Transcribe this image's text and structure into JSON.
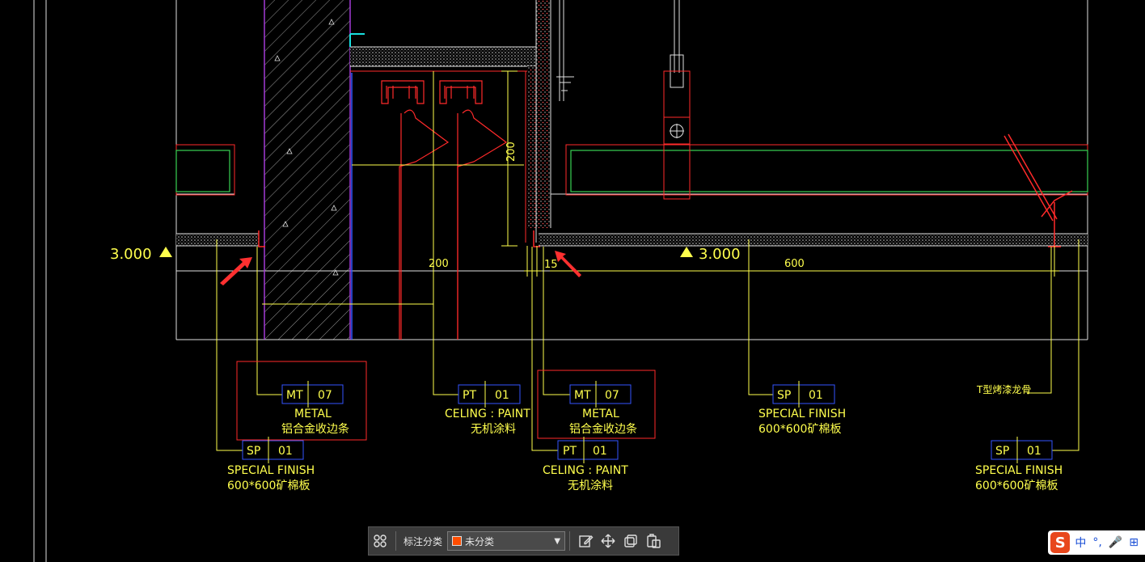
{
  "drawing": {
    "elevations": [
      "3.000",
      "3.000"
    ],
    "dimensions": {
      "d200_horizontal": "200",
      "d200_vertical": "200",
      "d15": "15",
      "d600": "600"
    },
    "callouts": [
      {
        "code": "MT",
        "number": "07",
        "line1": "METAL",
        "line2": "铝合金收边条",
        "boxed": true
      },
      {
        "code": "SP",
        "number": "01",
        "line1": "SPECIAL FINISH",
        "line2": "600*600矿棉板"
      },
      {
        "code": "PT",
        "number": "01",
        "line1": "CELING : PAINT",
        "line2": "无机涂料"
      },
      {
        "code": "MT",
        "number": "07",
        "line1": "METAL",
        "line2": "铝合金收边条",
        "boxed": true
      },
      {
        "code": "PT",
        "number": "01",
        "line1": "CELING : PAINT",
        "line2": "无机涂料"
      },
      {
        "code": "SP",
        "number": "01",
        "line1": "SPECIAL FINISH",
        "line2": "600*600矿棉板"
      },
      {
        "code": "SP",
        "number": "01",
        "line1": "SPECIAL FINISH",
        "line2": "600*600矿棉板"
      }
    ],
    "note_t_keel": "T型烤漆龙骨",
    "colors": {
      "background": "#000000",
      "yellow": "#ffff4d",
      "red": "#ff2a2a",
      "green": "#39d353",
      "purple": "#a23ad6",
      "blue": "#3355ff",
      "white": "#e0e0e0",
      "cyan": "#19e0e0"
    }
  },
  "toolbar": {
    "category_label": "标注分类",
    "category_value": "未分类",
    "category_color": "#ff4d00",
    "icons": [
      "grid-apps-icon",
      "edit-note-icon",
      "move-icon",
      "copy-icon",
      "paste-icon"
    ]
  },
  "ime": {
    "logo": "S",
    "items": [
      "中",
      "°,",
      "🎤",
      "⊞"
    ]
  }
}
